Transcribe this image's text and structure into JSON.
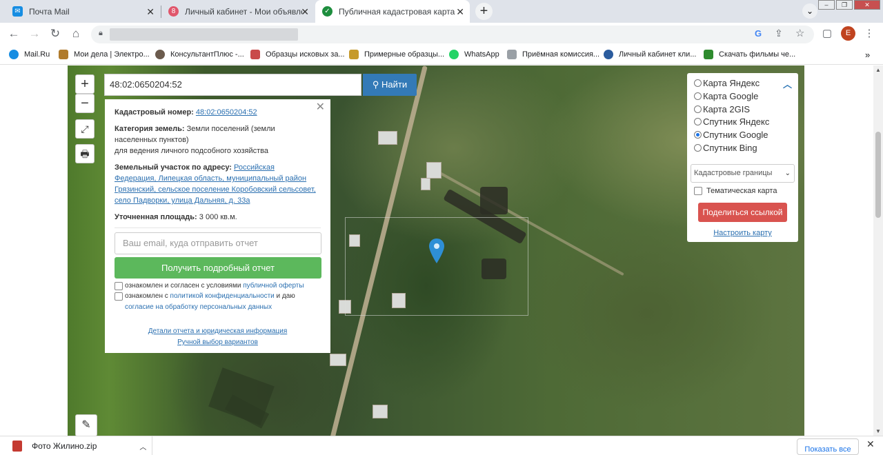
{
  "browser": {
    "tabs": [
      {
        "title": "Почта Mail",
        "favicon_color": "#168de2"
      },
      {
        "title": "Личный кабинет - Мои объявлени",
        "badge": "8",
        "favicon_color": "#e0566b"
      },
      {
        "title": "Публичная кадастровая карта - Р",
        "favicon_color": "#1e8e3e"
      }
    ],
    "bookmarks": [
      {
        "label": "Mail.Ru"
      },
      {
        "label": "Мои дела | Электро..."
      },
      {
        "label": "КонсультантПлюс -..."
      },
      {
        "label": "Образцы исковых за..."
      },
      {
        "label": "Примерные образцы..."
      },
      {
        "label": "WhatsApp"
      },
      {
        "label": "Приёмная комиссия..."
      },
      {
        "label": "Личный кабинет кли..."
      },
      {
        "label": "Скачать фильмы че..."
      }
    ],
    "profile_initial": "E"
  },
  "search": {
    "value": "48:02:0650204:52",
    "button_label": "Найти"
  },
  "controls": {
    "zoom_in": "+",
    "zoom_out": "−"
  },
  "info": {
    "cadastral_label": "Кадастровый номер:",
    "cadastral_number": "48:02:0650204:52",
    "category_label": "Категория земель:",
    "category_value_1": "Земли поселений (земли",
    "category_value_2": "населенных пунктов)",
    "usage": "для ведения личного подсобного хозяйства",
    "address_label": "Земельный участок по адресу:",
    "address_1": "Российская",
    "address_2": "Федерация, Липецкая область, муниципальный район",
    "address_3": "Грязинский, сельское поселение Коробовский сельсовет,",
    "address_4": "село Падворки, улица Дальняя, д. 33а",
    "area_label": "Уточненная площадь:",
    "area_value": "3 000 кв.м.",
    "email_placeholder": "Ваш email, куда отправить отчет",
    "report_button": "Получить подробный отчет",
    "agree_1_text": "ознакомлен и согласен с условиями",
    "agree_1_link": "публичной оферты",
    "agree_2_text": "ознакомлен с",
    "agree_2_link": "политикой конфиденциальности",
    "agree_2_text_b": "и даю",
    "agree_2_link_b": "согласие на обработку персональных данных",
    "details_link": "Детали отчета и юридическая информация",
    "manual_link": "Ручной выбор вариантов"
  },
  "layers": {
    "options": [
      {
        "label": "Карта Яндекс",
        "selected": false
      },
      {
        "label": "Карта Google",
        "selected": false
      },
      {
        "label": "Карта 2GIS",
        "selected": false
      },
      {
        "label": "Спутник Яндекс",
        "selected": false
      },
      {
        "label": "Спутник Google",
        "selected": true
      },
      {
        "label": "Спутник Bing",
        "selected": false
      }
    ],
    "select_value": "Кадастровые границы",
    "theme_label": "Тематическая карта",
    "share_button": "Поделиться ссылкой",
    "configure_link": "Настроить карту"
  },
  "downloads": {
    "file": "Фото Жилино.zip",
    "show_all": "Показать все"
  },
  "colors": {
    "search_button": "#337ab7",
    "report_button": "#5cb85c",
    "share_button": "#d9534f",
    "link": "#2a6fb0"
  }
}
